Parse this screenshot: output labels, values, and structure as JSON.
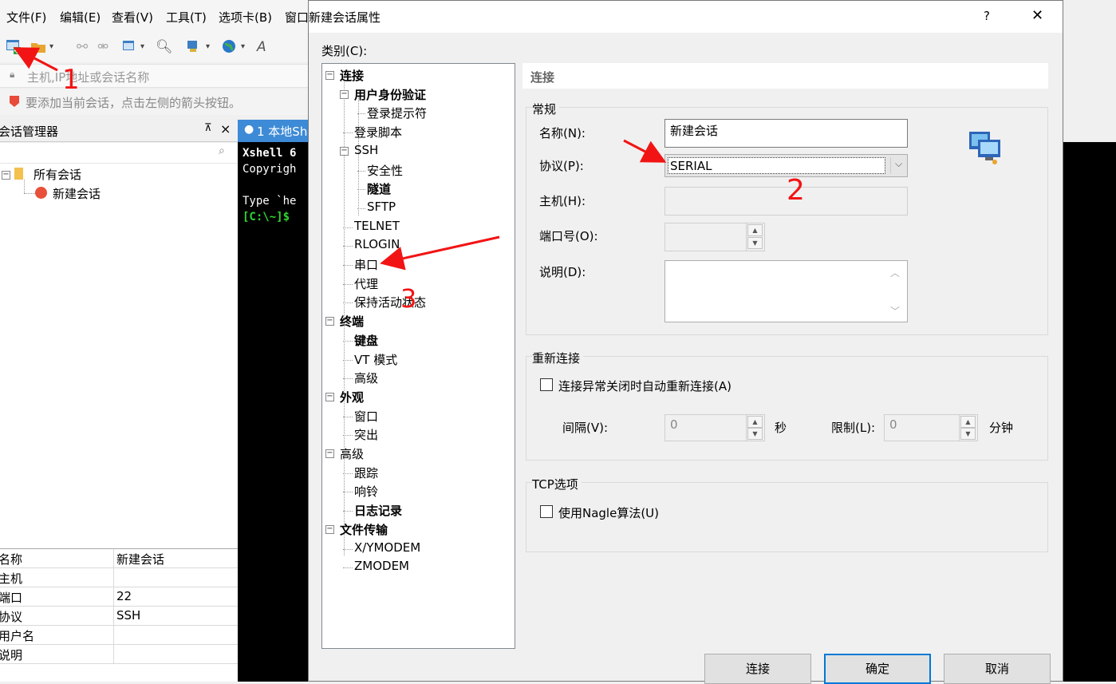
{
  "menubar": {
    "items": [
      "文件(F)",
      "编辑(E)",
      "查看(V)",
      "工具(T)",
      "选项卡(B)",
      "窗口"
    ]
  },
  "addressbar": {
    "placeholder": "主机,IP地址或会话名称"
  },
  "hintbar": {
    "text": "要添加当前会话，点击左侧的箭头按钮。"
  },
  "session_manager": {
    "title": "会话管理器",
    "pin": "⊼",
    "close": "×",
    "tree": {
      "root": "所有会话",
      "child": "新建会话"
    },
    "properties": [
      {
        "key": "名称",
        "value": "新建会话"
      },
      {
        "key": "主机",
        "value": ""
      },
      {
        "key": "端口",
        "value": "22"
      },
      {
        "key": "协议",
        "value": "SSH"
      },
      {
        "key": "用户名",
        "value": ""
      },
      {
        "key": "说明",
        "value": ""
      }
    ]
  },
  "tab": {
    "label": "1 本地Sh"
  },
  "terminal": {
    "lines": [
      "Xshell 6",
      "Copyrigh",
      "",
      "Type `he",
      "[C:\\~]$ "
    ]
  },
  "dialog": {
    "title": "新建会话属性",
    "help": "?",
    "close": "✕",
    "category_label": "类别(C):",
    "tree": [
      {
        "label": "连接",
        "bold": true
      },
      {
        "label": "用户身份验证",
        "bold": true
      },
      {
        "label": "登录提示符",
        "bold": false
      },
      {
        "label": "登录脚本",
        "bold": false
      },
      {
        "label": "SSH",
        "bold": false
      },
      {
        "label": "安全性",
        "bold": false
      },
      {
        "label": "隧道",
        "bold": true
      },
      {
        "label": "SFTP",
        "bold": false
      },
      {
        "label": "TELNET",
        "bold": false
      },
      {
        "label": "RLOGIN",
        "bold": false
      },
      {
        "label": "串口",
        "bold": false
      },
      {
        "label": "代理",
        "bold": false
      },
      {
        "label": "保持活动状态",
        "bold": false
      },
      {
        "label": "终端",
        "bold": true
      },
      {
        "label": "键盘",
        "bold": true
      },
      {
        "label": "VT 模式",
        "bold": false
      },
      {
        "label": "高级",
        "bold": false
      },
      {
        "label": "外观",
        "bold": true
      },
      {
        "label": "窗口",
        "bold": false
      },
      {
        "label": "突出",
        "bold": false
      },
      {
        "label": "高级",
        "bold": false
      },
      {
        "label": "跟踪",
        "bold": false
      },
      {
        "label": "响铃",
        "bold": false
      },
      {
        "label": "日志记录",
        "bold": true
      },
      {
        "label": "文件传输",
        "bold": true
      },
      {
        "label": "X/YMODEM",
        "bold": false
      },
      {
        "label": "ZMODEM",
        "bold": false
      }
    ],
    "section_header": "连接",
    "general": {
      "group": "常规",
      "name_label": "名称(N):",
      "name_value": "新建会话",
      "protocol_label": "协议(P):",
      "protocol_value": "SERIAL",
      "host_label": "主机(H):",
      "host_value": "",
      "port_label": "端口号(O):",
      "port_value": "",
      "desc_label": "说明(D):",
      "desc_value": ""
    },
    "reconnect": {
      "group": "重新连接",
      "checkbox": "连接异常关闭时自动重新连接(A)",
      "interval_label": "间隔(V):",
      "interval_value": "0",
      "interval_unit": "秒",
      "limit_label": "限制(L):",
      "limit_value": "0",
      "limit_unit": "分钟"
    },
    "tcp": {
      "group": "TCP选项",
      "checkbox": "使用Nagle算法(U)"
    },
    "buttons": {
      "connect": "连接",
      "ok": "确定",
      "cancel": "取消"
    }
  },
  "annotations": {
    "n1": "1",
    "n2": "2",
    "n3": "3"
  },
  "colors": {
    "accent": "#0078d7",
    "annotation": "#f21414",
    "tab": "#3d8ad6"
  }
}
